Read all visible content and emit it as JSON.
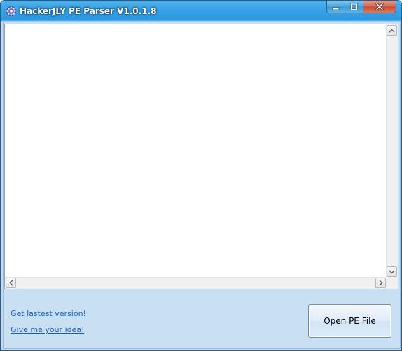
{
  "window": {
    "title": "HackerJLY PE Parser V1.0.1.8"
  },
  "output": {
    "text": ""
  },
  "links": {
    "latest_version": "Get lastest version!",
    "give_idea": "Give me your idea!"
  },
  "buttons": {
    "open_pe_file": "Open PE File"
  },
  "icons": {
    "app": "gear-icon",
    "minimize": "minimize-icon",
    "maximize": "maximize-icon",
    "close": "close-icon",
    "scroll_up": "chevron-up-icon",
    "scroll_down": "chevron-down-icon",
    "scroll_left": "chevron-left-icon",
    "scroll_right": "chevron-right-icon"
  },
  "colors": {
    "titlebar": "#37a3e6",
    "client_background": "#c9e0f3",
    "link": "#1a5fb4",
    "close_button": "#c64a32"
  }
}
